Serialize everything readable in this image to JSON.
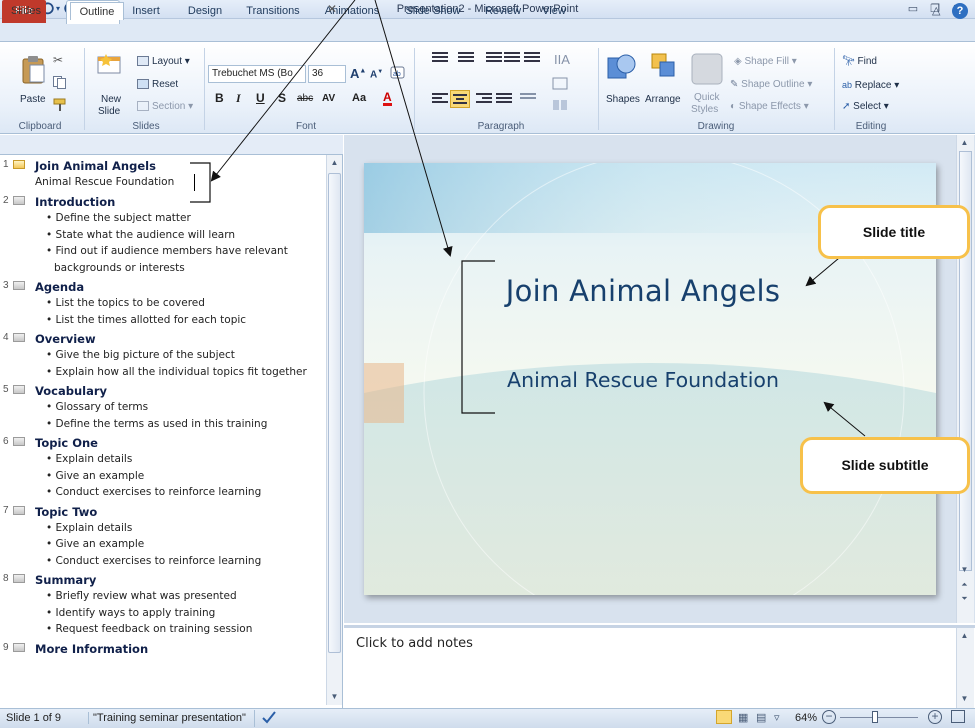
{
  "title_bar": {
    "app_logo": "P",
    "window_title": "Presentation2 - Microsoft PowerPoint",
    "icons": [
      "powerpoint-logo-icon",
      "save-icon",
      "undo-icon",
      "redo-icon",
      "customize-qat-icon",
      "minimize-icon",
      "restore-icon",
      "close-icon"
    ]
  },
  "tabs": [
    "File",
    "Home",
    "Insert",
    "Design",
    "Transitions",
    "Animations",
    "Slide Show",
    "Review",
    "View"
  ],
  "ribbon": {
    "clipboard": {
      "paste": "Paste",
      "label": "Clipboard"
    },
    "slides": {
      "new_slide_1": "New",
      "new_slide_2": "Slide",
      "layout": "Layout",
      "reset": "Reset",
      "section": "Section",
      "label": "Slides"
    },
    "font": {
      "font_name": "Trebuchet MS (Bo",
      "font_size": "36",
      "label": "Font",
      "bold": "B",
      "italic": "I",
      "underline": "U",
      "shadow": "S",
      "strike": "abc",
      "spacing": "AV",
      "case": "Aa",
      "color": "A"
    },
    "paragraph": {
      "label": "Paragraph"
    },
    "drawing": {
      "shapes": "Shapes",
      "arrange": "Arrange",
      "quick_styles_1": "Quick",
      "quick_styles_2": "Styles",
      "shape_fill": "Shape Fill",
      "shape_outline": "Shape Outline",
      "shape_effects": "Shape Effects",
      "label": "Drawing"
    },
    "editing": {
      "find": "Find",
      "replace": "Replace",
      "select": "Select",
      "label": "Editing"
    }
  },
  "panel_tabs": [
    "Slides",
    "Outline"
  ],
  "outline": [
    {
      "num": "1",
      "title": "Join Animal Angels",
      "subtitle": "Animal Rescue Foundation",
      "active": true
    },
    {
      "num": "2",
      "title": "Introduction",
      "bullets": [
        "Define the subject matter",
        "State what the audience will learn",
        "Find out if audience members have relevant backgrounds or interests"
      ]
    },
    {
      "num": "3",
      "title": "Agenda",
      "bullets": [
        "List the topics to be covered",
        "List the times allotted for each topic"
      ]
    },
    {
      "num": "4",
      "title": "Overview",
      "bullets": [
        "Give the big picture of the subject",
        "Explain how all the individual topics fit together"
      ]
    },
    {
      "num": "5",
      "title": "Vocabulary",
      "bullets": [
        "Glossary of terms",
        "Define the terms as used in this training"
      ]
    },
    {
      "num": "6",
      "title": "Topic One",
      "bullets": [
        "Explain details",
        "Give an example",
        "Conduct exercises to reinforce learning"
      ]
    },
    {
      "num": "7",
      "title": "Topic Two",
      "bullets": [
        "Explain details",
        "Give an example",
        "Conduct exercises to reinforce learning"
      ]
    },
    {
      "num": "8",
      "title": "Summary",
      "bullets": [
        "Briefly review what was presented",
        "Identify ways to apply training",
        "Request feedback on training session"
      ]
    },
    {
      "num": "9",
      "title": "More Information"
    }
  ],
  "slide": {
    "title": "Join Animal Angels",
    "subtitle": "Animal Rescue Foundation"
  },
  "notes_placeholder": "Click to add notes",
  "status": {
    "slide_pos": "Slide 1 of 9",
    "theme": "\"Training seminar presentation\"",
    "zoom": "64%"
  },
  "callouts": {
    "title": "Slide title",
    "subtitle": "Slide subtitle"
  }
}
